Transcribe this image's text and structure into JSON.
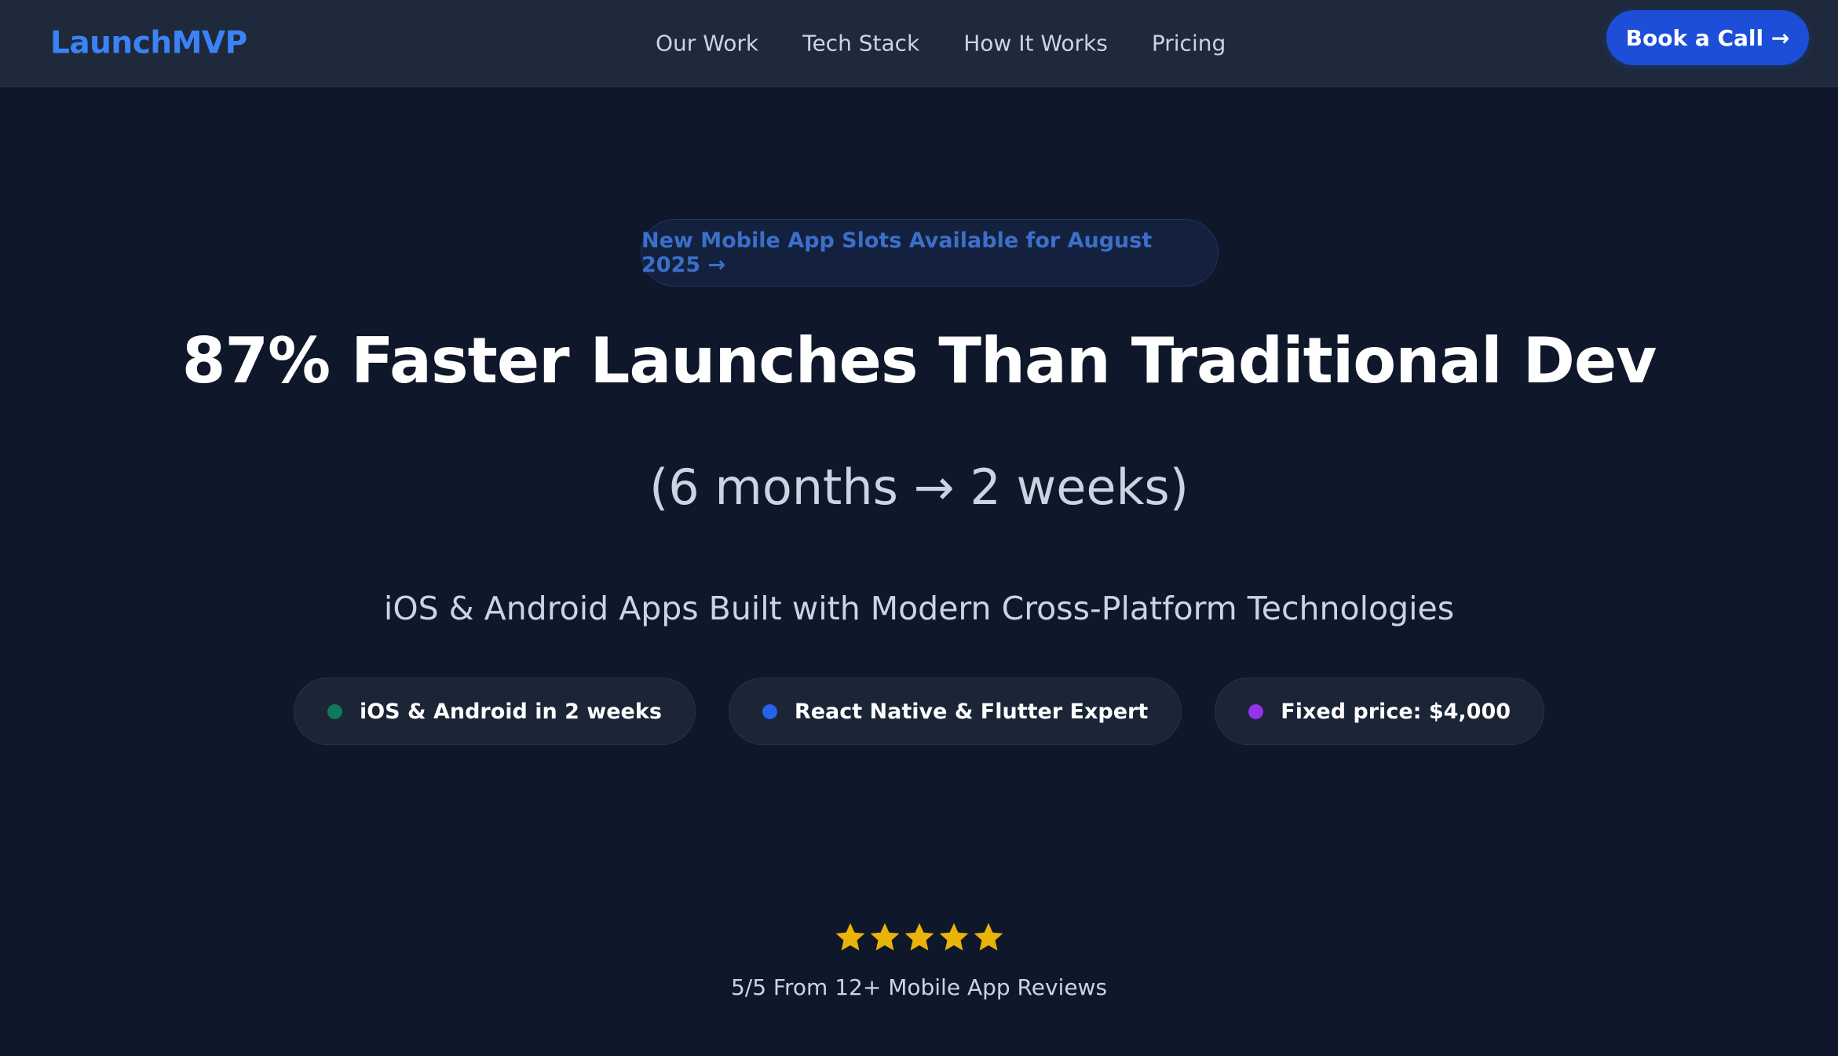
{
  "nav": {
    "logo": "LaunchMVP",
    "links": [
      "Our Work",
      "Tech Stack",
      "How It Works",
      "Pricing"
    ],
    "cta": "Book a Call →"
  },
  "hero": {
    "announcement": "New Mobile App Slots Available for August 2025 →",
    "headline": "87% Faster Launches Than Traditional Dev",
    "subheadline": "(6 months → 2 weeks)",
    "tagline": "iOS & Android Apps Built with Modern Cross-Platform Technologies",
    "pills": [
      {
        "label": "iOS & Android in 2 weeks",
        "dot_color": "#0f7a5a"
      },
      {
        "label": "React Native & Flutter Expert",
        "dot_color": "#2563eb"
      },
      {
        "label": "Fixed price: $4,000",
        "dot_color": "#9333ea"
      }
    ],
    "rating": {
      "stars": 5,
      "text": "5/5 From 12+ Mobile App Reviews",
      "star_color": "#eab308"
    }
  },
  "colors": {
    "background": "#0f172a",
    "navbar": "#1e293b",
    "accent": "#3b82f6",
    "cta": "#1d4ed8"
  }
}
